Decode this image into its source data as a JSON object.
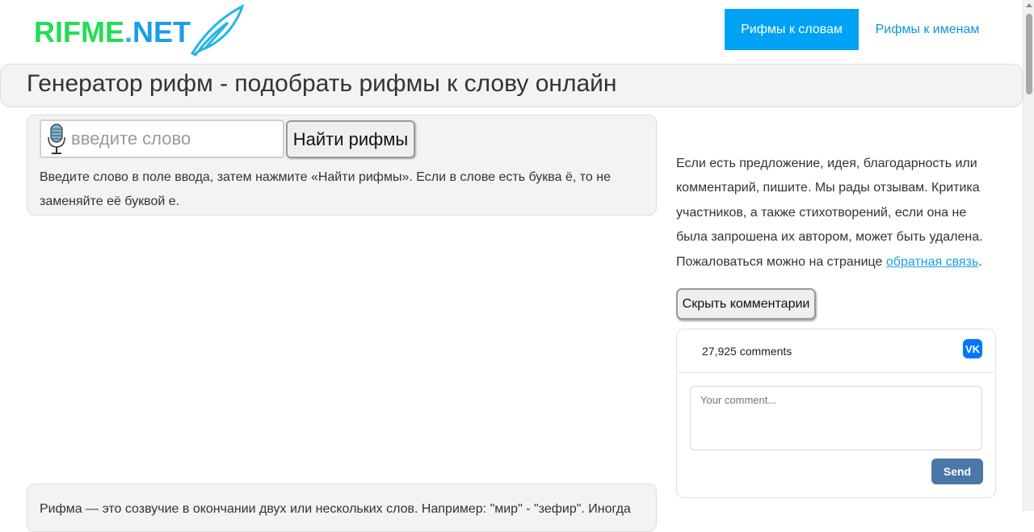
{
  "logo": {
    "part1": "RIFME",
    "part2": ".",
    "part3": "NET",
    "colors": {
      "rifme": "#22dd55",
      "net": "#1a9ee6",
      "feather": "#27b5e5"
    }
  },
  "nav": {
    "items": [
      {
        "label": "Рифмы к словам",
        "active": true
      },
      {
        "label": "Рифмы к именам",
        "active": false
      }
    ],
    "accent": "#00a2f5"
  },
  "page": {
    "title": "Генератор рифм - подобрать рифмы к слову онлайн"
  },
  "search": {
    "placeholder": "введите слово",
    "button_label": "Найти рифмы",
    "help": "Введите слово в поле ввода, затем нажмите «Найти рифмы». Если в слове есть буква ё, то не заменяйте её буквой е.",
    "mic_icon": "microphone-icon"
  },
  "bottom": {
    "text": "Рифма — это созвучие в окончании двух или нескольких слов. Например: \"мир\" - \"зефир\". Иногда"
  },
  "sidebar": {
    "note_text": "Если есть предложение, идея, благодарность или комментарий, пишите. Мы рады отзывам. Критика участников, а также стихотворений, если она не была запрошена их автором, может быть удалена. Пожаловаться можно на странице ",
    "note_link": "обратная связь",
    "note_end": ".",
    "hide_button": "Скрыть комментарии"
  },
  "vk": {
    "count": "27,925 comments",
    "placeholder": "Your comment...",
    "send": "Send",
    "logo_text": "VK",
    "accent": "#4a76a8"
  }
}
